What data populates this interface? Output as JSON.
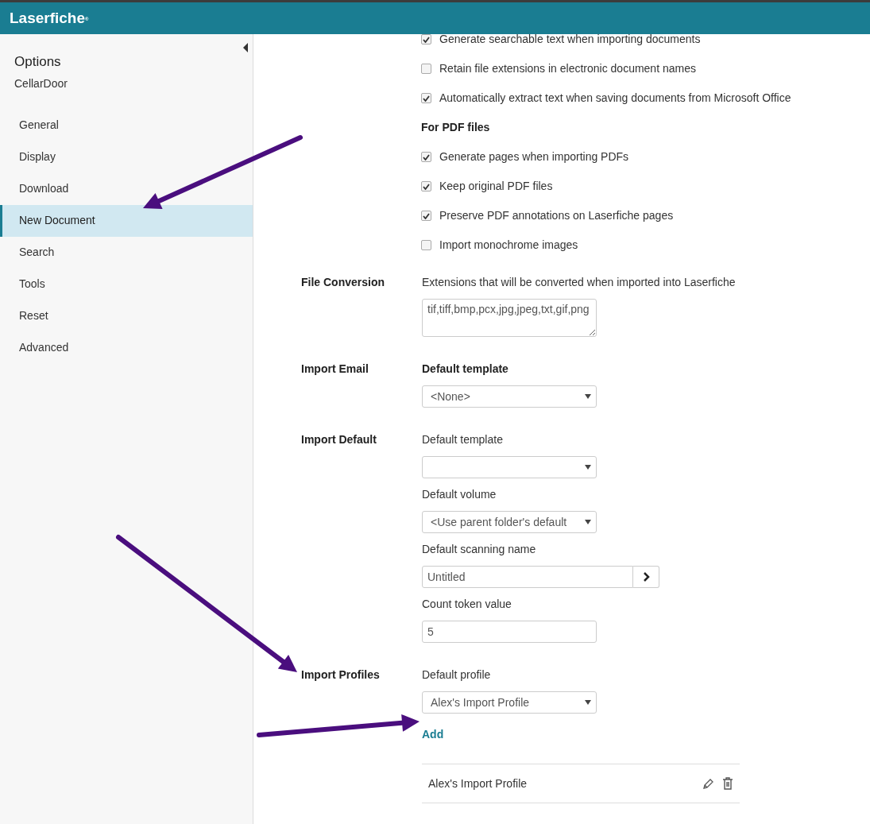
{
  "app": {
    "logo": "Laserfiche",
    "logo_mark": "®"
  },
  "sidebar": {
    "title": "Options",
    "subtitle": "CellarDoor",
    "items": [
      {
        "label": "General",
        "selected": false
      },
      {
        "label": "Display",
        "selected": false
      },
      {
        "label": "Download",
        "selected": false
      },
      {
        "label": "New Document",
        "selected": true
      },
      {
        "label": "Search",
        "selected": false
      },
      {
        "label": "Tools",
        "selected": false
      },
      {
        "label": "Reset",
        "selected": false
      },
      {
        "label": "Advanced",
        "selected": false
      }
    ]
  },
  "options": [
    {
      "kind": "checkbox",
      "label": "Generate searchable text when importing documents",
      "checked": true
    },
    {
      "kind": "checkbox",
      "label": "Retain file extensions in electronic document names",
      "checked": false
    },
    {
      "kind": "checkbox",
      "label": "Automatically extract text when saving documents from Microsoft Office",
      "checked": true
    },
    {
      "kind": "heading",
      "label": "For PDF files"
    },
    {
      "kind": "checkbox",
      "label": "Generate pages when importing PDFs",
      "checked": true
    },
    {
      "kind": "checkbox",
      "label": "Keep original PDF files",
      "checked": true
    },
    {
      "kind": "checkbox",
      "label": "Preserve PDF annotations on Laserfiche pages",
      "checked": true
    },
    {
      "kind": "checkbox",
      "label": "Import monochrome images",
      "checked": false
    }
  ],
  "sections": [
    {
      "title": "File Conversion",
      "fields": [
        {
          "kind": "caption",
          "text": "Extensions that will be converted when imported into Laserfiche"
        },
        {
          "kind": "textarea",
          "value": "tif,tiff,bmp,pcx,jpg,jpeg,txt,gif,png"
        }
      ]
    },
    {
      "title": "Import Email",
      "fields": [
        {
          "kind": "heading",
          "text": "Default template"
        },
        {
          "kind": "select",
          "value": "<None>"
        }
      ]
    },
    {
      "title": "Import Default",
      "fields": [
        {
          "kind": "caption",
          "text": "Default template"
        },
        {
          "kind": "select"
        },
        {
          "kind": "caption",
          "text": "Default volume"
        },
        {
          "kind": "select",
          "value": "<Use parent folder's default"
        },
        {
          "kind": "caption",
          "text": "Default scanning name"
        },
        {
          "kind": "input_button",
          "value": "Untitled"
        },
        {
          "kind": "caption",
          "text": "Count token value"
        },
        {
          "kind": "input",
          "value": "5"
        }
      ]
    },
    {
      "title": "Import Profiles",
      "fields": [
        {
          "kind": "caption",
          "text": "Default profile"
        },
        {
          "kind": "select",
          "value": "Alex's Import Profile"
        },
        {
          "kind": "link",
          "text": "Add"
        },
        {
          "kind": "list",
          "items": [
            "Alex's Import Profile"
          ]
        }
      ]
    }
  ]
}
